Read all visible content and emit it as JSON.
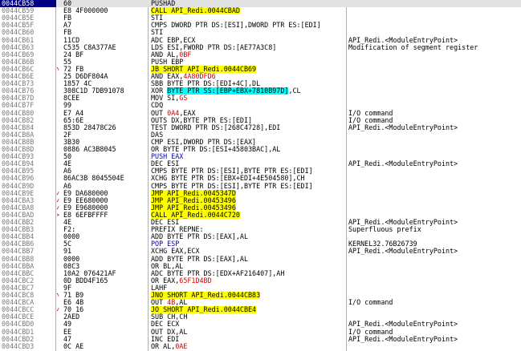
{
  "colors": {
    "address": "#7a7a7a",
    "selected_address_bg": "#000080",
    "selected_row_bg": "#e2e2e2",
    "jump_highlight": "#ffff00",
    "operand_highlight": "#00ffff",
    "red_text": "#d40000",
    "blue_text": "#0000c8",
    "purple_text": "#800080"
  },
  "rows": [
    {
      "addr": "0044CB58",
      "hex": "60",
      "dis": [
        {
          "t": "PUSHAD"
        }
      ],
      "cmt": "",
      "selected": true
    },
    {
      "addr": "0044CB59",
      "hex": "E8 4F000000",
      "dis": [
        {
          "t": "CALL API_Redi.0044CBAD",
          "c": "hl-y"
        }
      ],
      "cmt": ""
    },
    {
      "addr": "0044CB5E",
      "hex": "FB",
      "dis": [
        {
          "t": "STI"
        }
      ],
      "cmt": ""
    },
    {
      "addr": "0044CB5F",
      "hex": "A7",
      "dis": [
        {
          "t": "CMPS DWORD PTR DS:[ESI],DWORD PTR ES:[EDI]"
        }
      ],
      "cmt": ""
    },
    {
      "addr": "0044CB60",
      "hex": "FB",
      "dis": [
        {
          "t": "STI"
        }
      ],
      "cmt": ""
    },
    {
      "addr": "0044CB61",
      "hex": "11CD",
      "dis": [
        {
          "t": "ADC EBP,ECX"
        }
      ],
      "cmt": "API_Redi.<ModuleEntryPoint>"
    },
    {
      "addr": "0044CB63",
      "hex": "C535 C8A377AE",
      "dis": [
        {
          "t": "LDS ESI,FWORD PTR DS:[AE77A3C8]"
        }
      ],
      "cmt": "Modification of segment register"
    },
    {
      "addr": "0044CB69",
      "hex": "24 BF",
      "dis": [
        {
          "t": "AND AL,"
        },
        {
          "t": "0BF",
          "c": "red"
        }
      ],
      "cmt": ""
    },
    {
      "addr": "0044CB6B",
      "hex": "55",
      "dis": [
        {
          "t": "PUSH EBP"
        }
      ],
      "cmt": ""
    },
    {
      "addr": "0044CB6C",
      "hex": "72 FB",
      "arrow": "^",
      "dis": [
        {
          "t": "JB SHORT API_Redi.0044CB69",
          "c": "hl-y"
        }
      ],
      "cmt": ""
    },
    {
      "addr": "0044CB6E",
      "hex": "25 D6DF804A",
      "dis": [
        {
          "t": "AND EAX,"
        },
        {
          "t": "4A80DFD6",
          "c": "red"
        }
      ],
      "cmt": ""
    },
    {
      "addr": "0044CB73",
      "hex": "1857 4C",
      "dis": [
        {
          "t": "SBB BYTE PTR DS:[EDI+4C],DL"
        }
      ],
      "cmt": ""
    },
    {
      "addr": "0044CB76",
      "hex": "308C1D 7DB91078",
      "dis": [
        {
          "t": "XOR "
        },
        {
          "t": "BYTE PTR SS:[EBP+EBX+7810B97D]",
          "c": "hl-c"
        },
        {
          "t": ",CL"
        }
      ],
      "cmt": ""
    },
    {
      "addr": "0044CB7D",
      "hex": "8CEE",
      "dis": [
        {
          "t": "MOV SI,"
        },
        {
          "t": "GS",
          "c": "red"
        }
      ],
      "cmt": ""
    },
    {
      "addr": "0044CB7F",
      "hex": "99",
      "dis": [
        {
          "t": "CDQ"
        }
      ],
      "cmt": ""
    },
    {
      "addr": "0044CB80",
      "hex": "E7 A4",
      "dis": [
        {
          "t": "OUT "
        },
        {
          "t": "0A4",
          "c": "red"
        },
        {
          "t": ",EAX"
        }
      ],
      "cmt": "I/O command"
    },
    {
      "addr": "0044CB82",
      "hex": "65:6E",
      "dis": [
        {
          "t": "OUTS DX,BYTE PTR ES:[EDI]"
        }
      ],
      "cmt": "I/O command"
    },
    {
      "addr": "0044CB84",
      "hex": "853D 28478C26",
      "dis": [
        {
          "t": "TEST DWORD PTR DS:[268C4728],EDI"
        }
      ],
      "cmt": "API_Redi.<ModuleEntryPoint>"
    },
    {
      "addr": "0044CB8A",
      "hex": "2F",
      "dis": [
        {
          "t": "DAS"
        }
      ],
      "cmt": ""
    },
    {
      "addr": "0044CB8B",
      "hex": "3B30",
      "dis": [
        {
          "t": "CMP ESI,DWORD PTR DS:[EAX]"
        }
      ],
      "cmt": ""
    },
    {
      "addr": "0044CB8D",
      "hex": "0886 AC3B8045",
      "dis": [
        {
          "t": "OR BYTE PTR DS:[ESI+45803BAC],AL"
        }
      ],
      "cmt": ""
    },
    {
      "addr": "0044CB93",
      "hex": "50",
      "dis": [
        {
          "t": "PUSH EAX",
          "c": "blue"
        }
      ],
      "cmt": ""
    },
    {
      "addr": "0044CB94",
      "hex": "4E",
      "dis": [
        {
          "t": "DEC ESI"
        }
      ],
      "cmt": "API_Redi.<ModuleEntryPoint>"
    },
    {
      "addr": "0044CB95",
      "hex": "A6",
      "dis": [
        {
          "t": "CMPS BYTE PTR DS:[ESI],BYTE PTR ES:[EDI]"
        }
      ],
      "cmt": ""
    },
    {
      "addr": "0044CB96",
      "hex": "86AC3B 8045504E",
      "dis": [
        {
          "t": "XCHG BYTE PTR DS:[EBX+EDI+4E504580],CH"
        }
      ],
      "cmt": ""
    },
    {
      "addr": "0044CB9D",
      "hex": "A6",
      "dis": [
        {
          "t": "CMPS BYTE PTR DS:[ESI],BYTE PTR ES:[EDI]"
        }
      ],
      "cmt": ""
    },
    {
      "addr": "0044CB9E",
      "hex": "E9 DA680000",
      "arrow": "v",
      "dis": [
        {
          "t": "JMP API_Redi.0045347D",
          "c": "hl-y"
        }
      ],
      "cmt": ""
    },
    {
      "addr": "0044CBA3",
      "hex": "E9 EE680000",
      "arrow": "v",
      "dis": [
        {
          "t": "JMP API_Redi.00453496",
          "c": "hl-y"
        }
      ],
      "cmt": ""
    },
    {
      "addr": "0044CBA8",
      "hex": "E9 E9680000",
      "arrow": "v",
      "dis": [
        {
          "t": "JMP API_Redi.00453496",
          "c": "hl-y"
        }
      ],
      "cmt": ""
    },
    {
      "addr": "0044CBAD",
      "hex": "E8 6EFBFFFF",
      "arrow": ">",
      "dis": [
        {
          "t": "CALL API_Redi.0044C720",
          "c": "hl-y"
        }
      ],
      "cmt": ""
    },
    {
      "addr": "0044CBB2",
      "hex": "4E",
      "dis": [
        {
          "t": "DEC ESI"
        }
      ],
      "cmt": "API_Redi.<ModuleEntryPoint>"
    },
    {
      "addr": "0044CBB3",
      "hex": "F2:",
      "dis": [
        {
          "t": "PREFIX REPNE:"
        }
      ],
      "cmt": "Superfluous prefix"
    },
    {
      "addr": "0044CBB4",
      "hex": "0000",
      "dis": [
        {
          "t": "ADD BYTE PTR DS:[EAX],AL"
        }
      ],
      "cmt": ""
    },
    {
      "addr": "0044CBB6",
      "hex": "5C",
      "dis": [
        {
          "t": "POP ESP",
          "c": "blue"
        }
      ],
      "cmt": "KERNEL32.76B26739"
    },
    {
      "addr": "0044CBB7",
      "hex": "91",
      "dis": [
        {
          "t": "XCHG EAX,ECX"
        }
      ],
      "cmt": "API_Redi.<ModuleEntryPoint>"
    },
    {
      "addr": "0044CBB8",
      "hex": "0000",
      "dis": [
        {
          "t": "ADD BYTE PTR DS:[EAX],AL"
        }
      ],
      "cmt": ""
    },
    {
      "addr": "0044CBBA",
      "hex": "08C3",
      "dis": [
        {
          "t": "OR BL,AL"
        }
      ],
      "cmt": ""
    },
    {
      "addr": "0044CBBC",
      "hex": "10A2 076421AF",
      "dis": [
        {
          "t": "ADC BYTE PTR DS:[EDX+AF216407],AH"
        }
      ],
      "cmt": ""
    },
    {
      "addr": "0044CBC2",
      "hex": "0D BDD4F165",
      "dis": [
        {
          "t": "OR EAX,"
        },
        {
          "t": "65F1D4BD",
          "c": "red"
        }
      ],
      "cmt": ""
    },
    {
      "addr": "0044CBC7",
      "hex": "9F",
      "dis": [
        {
          "t": "LAHF"
        }
      ],
      "cmt": ""
    },
    {
      "addr": "0044CBC8",
      "hex": "71 B9",
      "arrow": "^",
      "dis": [
        {
          "t": "JNO SHORT API_Redi.0044CB83",
          "c": "hl-y"
        }
      ],
      "cmt": ""
    },
    {
      "addr": "0044CBCA",
      "hex": "E6 4B",
      "dis": [
        {
          "t": "OUT "
        },
        {
          "t": "4B",
          "c": "red"
        },
        {
          "t": ",AL"
        }
      ],
      "cmt": "I/O command"
    },
    {
      "addr": "0044CBCC",
      "hex": "70 16",
      "arrow": "v",
      "dis": [
        {
          "t": "JO SHORT API_Redi.0044CBE4",
          "c": "hl-y"
        }
      ],
      "cmt": ""
    },
    {
      "addr": "0044CBCE",
      "hex": "2AED",
      "dis": [
        {
          "t": "SUB CH,CH"
        }
      ],
      "cmt": ""
    },
    {
      "addr": "0044CBD0",
      "hex": "49",
      "dis": [
        {
          "t": "DEC ECX"
        }
      ],
      "cmt": "API_Redi.<ModuleEntryPoint>"
    },
    {
      "addr": "0044CBD1",
      "hex": "EE",
      "dis": [
        {
          "t": "OUT DX,AL"
        }
      ],
      "cmt": "I/O command"
    },
    {
      "addr": "0044CBD2",
      "hex": "47",
      "dis": [
        {
          "t": "INC EDI"
        }
      ],
      "cmt": "API_Redi.<ModuleEntryPoint>"
    },
    {
      "addr": "0044CBD3",
      "hex": "0C AE",
      "dis": [
        {
          "t": "OR AL,"
        },
        {
          "t": "0AE",
          "c": "red"
        }
      ],
      "cmt": ""
    }
  ]
}
